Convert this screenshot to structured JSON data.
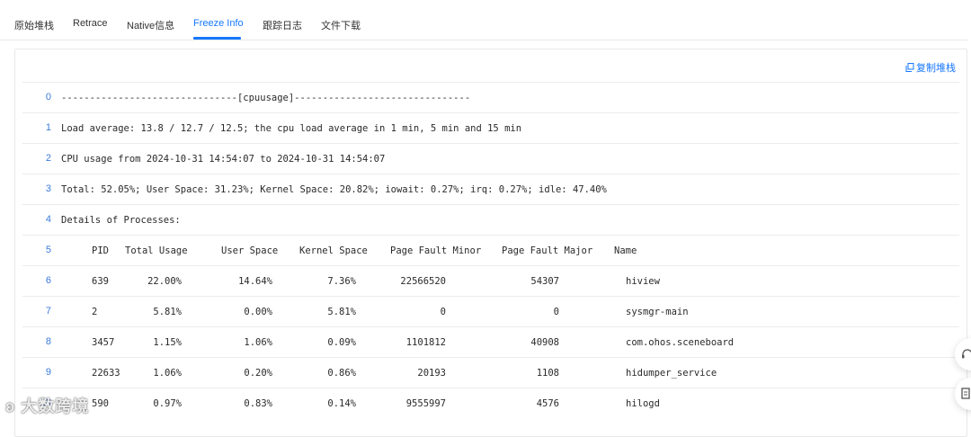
{
  "tabs": [
    {
      "label": "原始堆栈",
      "active": false
    },
    {
      "label": "Retrace",
      "active": false
    },
    {
      "label": "Native信息",
      "active": false
    },
    {
      "label": "Freeze Info",
      "active": true
    },
    {
      "label": "跟踪日志",
      "active": false
    },
    {
      "label": "文件下载",
      "active": false
    }
  ],
  "toolbar": {
    "copy_label": "复制堆栈"
  },
  "lines": [
    {
      "n": "0",
      "text": "-------------------------------[cpuusage]-------------------------------"
    },
    {
      "n": "1",
      "text": "Load average: 13.8 / 12.7 / 12.5; the cpu load average in 1 min, 5 min and 15 min"
    },
    {
      "n": "2",
      "text": "CPU usage from 2024-10-31 14:54:07 to 2024-10-31 14:54:07"
    },
    {
      "n": "3",
      "text": "Total: 52.05%; User Space: 31.23%; Kernel Space: 20.82%; iowait: 0.27%; irq: 0.27%; idle: 47.40%"
    },
    {
      "n": "4",
      "text": "Details of Processes:"
    }
  ],
  "table_header": {
    "n": "5",
    "pid": "PID",
    "total": "Total Usage",
    "user": "User Space",
    "kernel": "Kernel Space",
    "minor": "Page Fault Minor",
    "major": "Page Fault Major",
    "name": "Name"
  },
  "rows": [
    {
      "n": "6",
      "pid": "639",
      "total": "22.00%",
      "user": "14.64%",
      "kernel": "7.36%",
      "minor": "22566520",
      "major": "54307",
      "name": "hiview"
    },
    {
      "n": "7",
      "pid": "2",
      "total": "5.81%",
      "user": "0.00%",
      "kernel": "5.81%",
      "minor": "0",
      "major": "0",
      "name": "sysmgr-main"
    },
    {
      "n": "8",
      "pid": "3457",
      "total": "1.15%",
      "user": "1.06%",
      "kernel": "0.09%",
      "minor": "1101812",
      "major": "40908",
      "name": "com.ohos.sceneboard"
    },
    {
      "n": "9",
      "pid": "22633",
      "total": "1.06%",
      "user": "0.20%",
      "kernel": "0.86%",
      "minor": "20193",
      "major": "1108",
      "name": "hidumper_service"
    },
    {
      "n": "10",
      "pid": "590",
      "total": "0.97%",
      "user": "0.83%",
      "kernel": "0.14%",
      "minor": "9555997",
      "major": "4576",
      "name": "hilogd"
    }
  ],
  "watermark": "大数跨境",
  "colors": {
    "accent": "#1677ff",
    "line_number": "#3b7bd8",
    "border": "#e8e8e8"
  }
}
